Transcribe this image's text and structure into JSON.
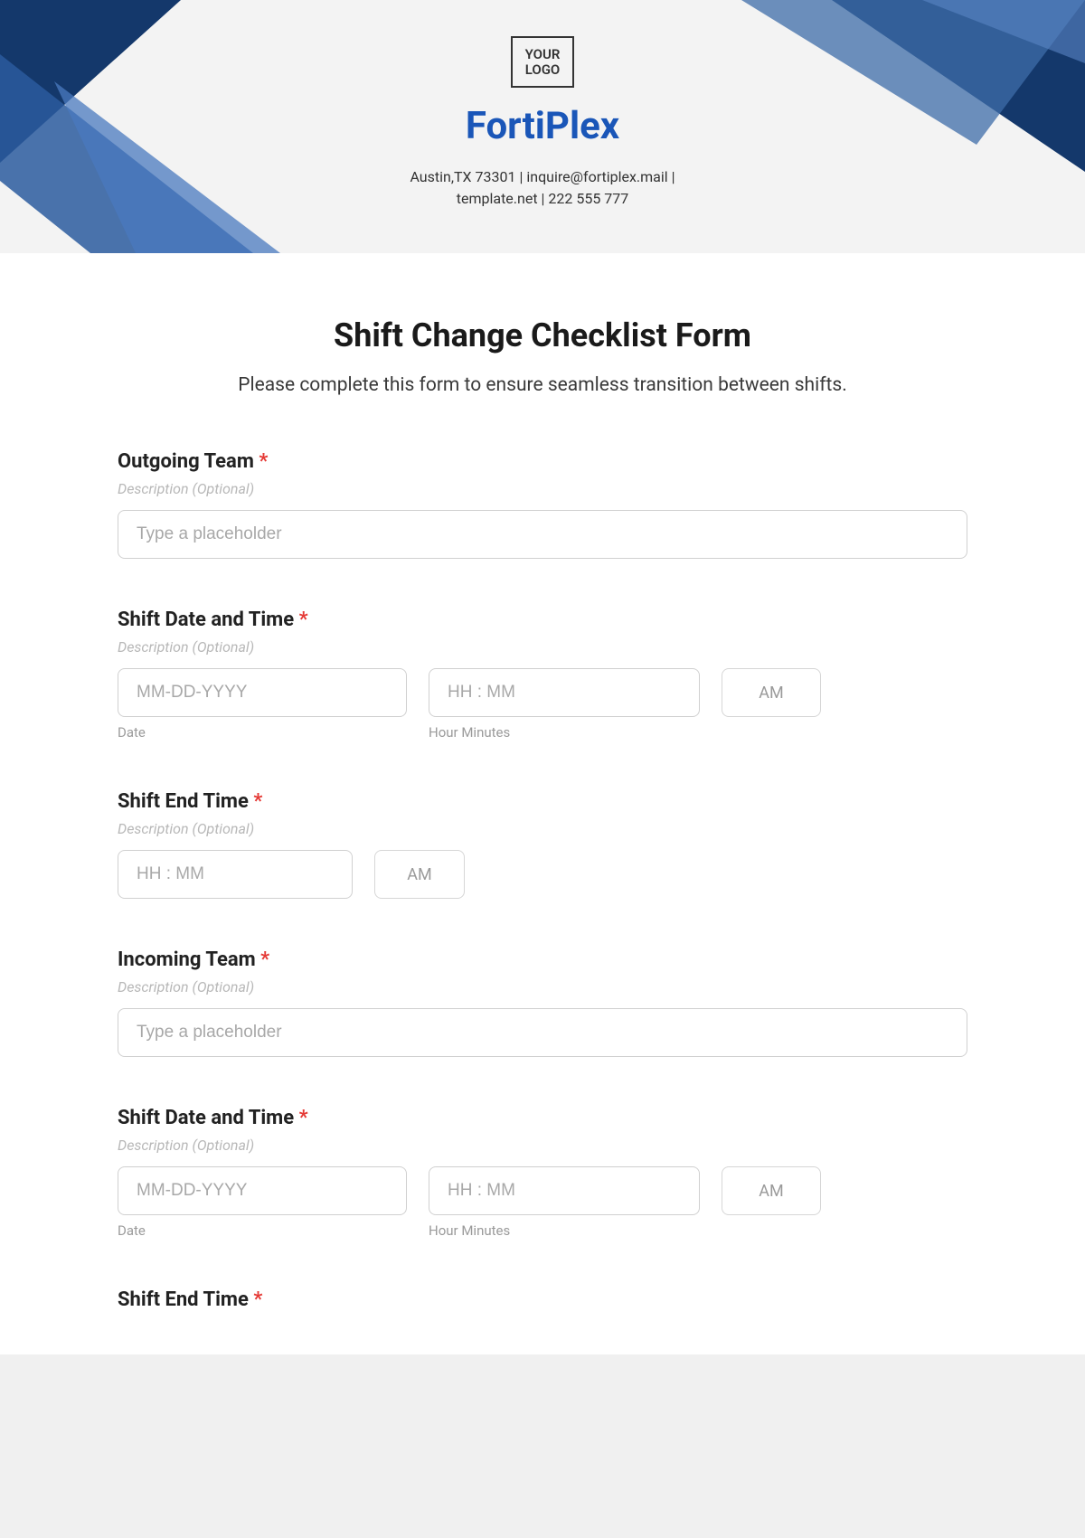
{
  "header": {
    "logo_line1": "YOUR",
    "logo_line2": "LOGO",
    "company": "FortiPlex",
    "contact_line1": "Austin,TX 73301 | inquire@fortiplex.mail |",
    "contact_line2": "template.net | 222 555 777"
  },
  "form": {
    "title": "Shift Change Checklist Form",
    "subtitle": "Please complete this form to ensure seamless transition between shifts.",
    "desc_placeholder": "Description (Optional)",
    "text_placeholder": "Type a placeholder",
    "date_placeholder": "MM-DD-YYYY",
    "time_placeholder": "HH : MM",
    "ampm": "AM",
    "date_sub": "Date",
    "time_sub": "Hour Minutes",
    "fields": {
      "outgoing_team": "Outgoing Team",
      "shift_dt1": "Shift Date and Time",
      "shift_end1": "Shift End Time",
      "incoming_team": "Incoming Team",
      "shift_dt2": "Shift Date and Time",
      "shift_end2": "Shift End Time"
    },
    "asterisk": "*"
  }
}
